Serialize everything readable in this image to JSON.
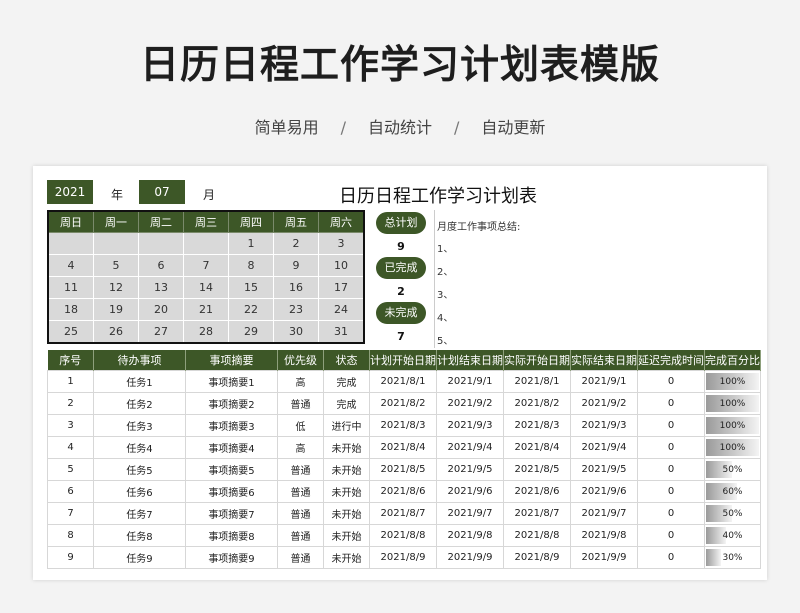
{
  "page": {
    "title": "日历日程工作学习计划表模版",
    "subtitle": [
      "简单易用",
      "自动统计",
      "自动更新"
    ],
    "separator": "/"
  },
  "sheet": {
    "title": "日历日程工作学习计划表",
    "year_value": "2021",
    "year_label": "年",
    "month_value": "07",
    "month_label": "月",
    "colors": {
      "accent": "#3d5727",
      "calendar_cell": "#d9d9d9"
    }
  },
  "calendar": {
    "weekdays": [
      "周日",
      "周一",
      "周二",
      "周三",
      "周四",
      "周五",
      "周六"
    ],
    "weeks": [
      [
        "",
        "",
        "",
        "",
        "1",
        "2",
        "3"
      ],
      [
        "4",
        "5",
        "6",
        "7",
        "8",
        "9",
        "10"
      ],
      [
        "11",
        "12",
        "13",
        "14",
        "15",
        "16",
        "17"
      ],
      [
        "18",
        "19",
        "20",
        "21",
        "22",
        "23",
        "24"
      ],
      [
        "25",
        "26",
        "27",
        "28",
        "29",
        "30",
        "31"
      ]
    ]
  },
  "stats": {
    "total_label": "总计划",
    "total_value": "9",
    "done_label": "已完成",
    "done_value": "2",
    "pending_label": "未完成",
    "pending_value": "7"
  },
  "summary": {
    "heading": "月度工作事项总结:",
    "lines": [
      "1、",
      "2、",
      "3、",
      "4、",
      "5、"
    ]
  },
  "tasks": {
    "columns": [
      "序号",
      "待办事项",
      "事项摘要",
      "优先级",
      "状态",
      "计划开始日期",
      "计划结束日期",
      "实际开始日期",
      "实际结束日期",
      "延迟完成时间",
      "完成百分比"
    ],
    "rows": [
      {
        "no": "1",
        "item": "任务1",
        "summary": "事项摘要1",
        "priority": "高",
        "status": "完成",
        "plan_start": "2021/8/1",
        "plan_end": "2021/9/1",
        "actual_start": "2021/8/1",
        "actual_end": "2021/9/1",
        "delay": "0",
        "progress": 1.0,
        "progress_label": "100%"
      },
      {
        "no": "2",
        "item": "任务2",
        "summary": "事项摘要2",
        "priority": "普通",
        "status": "完成",
        "plan_start": "2021/8/2",
        "plan_end": "2021/9/2",
        "actual_start": "2021/8/2",
        "actual_end": "2021/9/2",
        "delay": "0",
        "progress": 1.0,
        "progress_label": "100%"
      },
      {
        "no": "3",
        "item": "任务3",
        "summary": "事项摘要3",
        "priority": "低",
        "status": "进行中",
        "plan_start": "2021/8/3",
        "plan_end": "2021/9/3",
        "actual_start": "2021/8/3",
        "actual_end": "2021/9/3",
        "delay": "0",
        "progress": 1.0,
        "progress_label": "100%"
      },
      {
        "no": "4",
        "item": "任务4",
        "summary": "事项摘要4",
        "priority": "高",
        "status": "未开始",
        "plan_start": "2021/8/4",
        "plan_end": "2021/9/4",
        "actual_start": "2021/8/4",
        "actual_end": "2021/9/4",
        "delay": "0",
        "progress": 1.0,
        "progress_label": "100%"
      },
      {
        "no": "5",
        "item": "任务5",
        "summary": "事项摘要5",
        "priority": "普通",
        "status": "未开始",
        "plan_start": "2021/8/5",
        "plan_end": "2021/9/5",
        "actual_start": "2021/8/5",
        "actual_end": "2021/9/5",
        "delay": "0",
        "progress": 0.5,
        "progress_label": "50%"
      },
      {
        "no": "6",
        "item": "任务6",
        "summary": "事项摘要6",
        "priority": "普通",
        "status": "未开始",
        "plan_start": "2021/8/6",
        "plan_end": "2021/9/6",
        "actual_start": "2021/8/6",
        "actual_end": "2021/9/6",
        "delay": "0",
        "progress": 0.6,
        "progress_label": "60%"
      },
      {
        "no": "7",
        "item": "任务7",
        "summary": "事项摘要7",
        "priority": "普通",
        "status": "未开始",
        "plan_start": "2021/8/7",
        "plan_end": "2021/9/7",
        "actual_start": "2021/8/7",
        "actual_end": "2021/9/7",
        "delay": "0",
        "progress": 0.5,
        "progress_label": "50%"
      },
      {
        "no": "8",
        "item": "任务8",
        "summary": "事项摘要8",
        "priority": "普通",
        "status": "未开始",
        "plan_start": "2021/8/8",
        "plan_end": "2021/9/8",
        "actual_start": "2021/8/8",
        "actual_end": "2021/9/8",
        "delay": "0",
        "progress": 0.4,
        "progress_label": "40%"
      },
      {
        "no": "9",
        "item": "任务9",
        "summary": "事项摘要9",
        "priority": "普通",
        "status": "未开始",
        "plan_start": "2021/8/9",
        "plan_end": "2021/9/9",
        "actual_start": "2021/8/9",
        "actual_end": "2021/9/9",
        "delay": "0",
        "progress": 0.3,
        "progress_label": "30%"
      }
    ]
  }
}
